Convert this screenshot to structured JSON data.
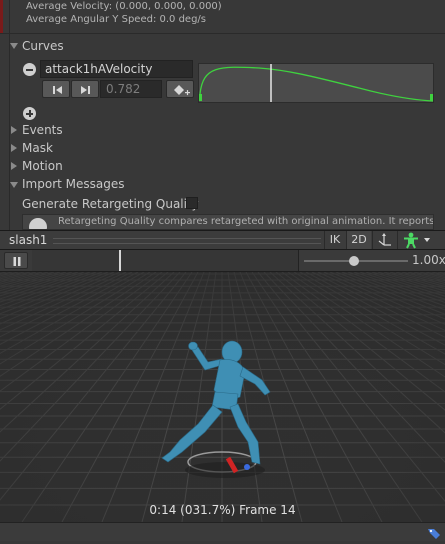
{
  "inspector": {
    "avg_velocity": "Average Velocity: (0.000, 0.000, 0.000)",
    "avg_angular_speed": "Average Angular Y Speed: 0.0 deg/s",
    "curves_label": "Curves",
    "curve": {
      "name": "attack1hAVelocity",
      "value": "0.782"
    },
    "sections": [
      "Events",
      "Mask",
      "Motion",
      "Import Messages"
    ],
    "retarget_label": "Generate Retargeting Quality",
    "retarget_checked": false,
    "help_text": "Retargeting Quality compares retargeted with original animation. It reports"
  },
  "preview": {
    "clip_name": "slash1",
    "ik_label": "IK",
    "twod_label": "2D",
    "speed_value": "1.00x",
    "frame_info": "0:14 (031.7%) Frame 14"
  },
  "colors": {
    "accent_green": "#3fd23f",
    "figure_blue": "#3f8fb4",
    "grid": "#4a4a4a"
  }
}
